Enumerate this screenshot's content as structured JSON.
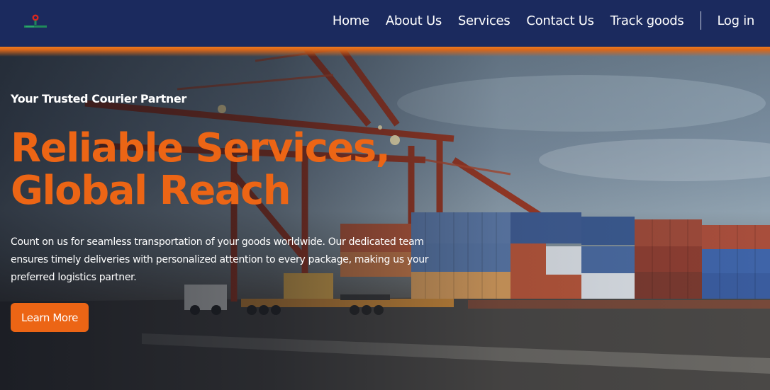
{
  "nav": {
    "logo_icon": "company-logo-icon",
    "links": [
      "Home",
      "About Us",
      "Services",
      "Contact Us",
      "Track goods"
    ],
    "login": "Log in"
  },
  "hero": {
    "tagline": "Your Trusted Courier Partner",
    "headline_line1": "Reliable Services,",
    "headline_line2": "Global Reach",
    "description": "Count on us for seamless transportation of your goods worldwide. Our dedicated team ensures timely deliveries with personalized attention to every package, making us your preferred logistics partner.",
    "cta": "Learn More",
    "background_image": "shipping-port-containers-cranes"
  },
  "colors": {
    "nav_bg": "#1b2a5e",
    "accent": "#ec6515",
    "text": "#ffffff"
  }
}
